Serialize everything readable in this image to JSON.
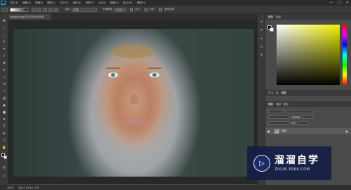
{
  "menubar": {
    "logo": "Ps",
    "items": [
      "文件(F)",
      "编辑(E)",
      "图像(I)",
      "图层(L)",
      "文字(Y)",
      "选择(S)",
      "滤镜(T)",
      "3D(D)",
      "视图(V)",
      "窗口(W)",
      "帮助(H)"
    ],
    "window_controls": [
      "—",
      "□",
      "✕"
    ]
  },
  "options": {
    "mode_label": "模式",
    "mode_value": "正常",
    "opacity_label": "不透明度",
    "opacity_value": "100%",
    "reverse_label": "反向",
    "dither_label": "仿色",
    "transparency_label": "透明区域"
  },
  "document": {
    "tab_title": "bingjing.jpg @ 100%(RGB/8)",
    "zoom": "100%",
    "doc_info": "文档:1.07M/1.07M"
  },
  "colors": {
    "foreground": "#000000",
    "background": "#ffffff",
    "accent": "#2fa3f0"
  },
  "panels": {
    "color_tabs": [
      "颜色",
      "色板"
    ],
    "library_tabs": [
      "学习",
      "库",
      "调整"
    ],
    "layers_tabs": [
      "图层",
      "通道",
      "路径"
    ],
    "layer": {
      "name": "背景",
      "visible_icon": "eye-icon",
      "lock_icon": "lock-icon"
    },
    "layer_options": {
      "opacity_label": "不透明度",
      "fill_label": "填充"
    }
  },
  "watermark": {
    "title": "溜溜自学",
    "url": "ZIXUE.3D66.COM"
  }
}
